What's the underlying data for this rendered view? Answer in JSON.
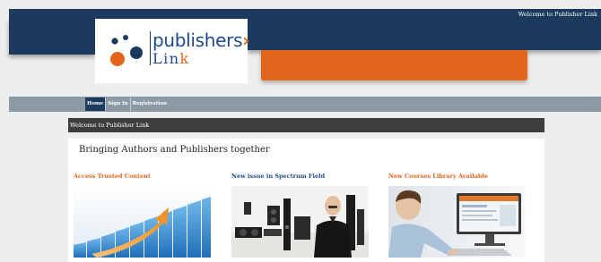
{
  "header": {
    "welcome_text": "Welcome to Publisher Link",
    "logo_word_1": "publishers",
    "logo_chevron": "›",
    "logo_word_2_main": "Lin",
    "logo_word_2_accent": "k"
  },
  "nav": {
    "items": [
      {
        "label": "Home",
        "active": true
      },
      {
        "label": "Sign In",
        "active": false
      },
      {
        "label": "Registration",
        "active": false
      }
    ]
  },
  "welcome_bar": {
    "text": "Welcome to Publisher Link"
  },
  "main": {
    "tagline": "Bringing Authors and Publishers together",
    "cards": [
      {
        "title": "Access Trusted Content",
        "title_color": "#e2651c",
        "image": "growth-arrow-graph"
      },
      {
        "title": "New issue in Spectrum Field",
        "title_color": "#1e4a8a",
        "image": "man-with-speakers-photo"
      },
      {
        "title": "New Courses Library Available",
        "title_color": "#e2651c",
        "image": "person-at-computer-photo"
      }
    ]
  },
  "colors": {
    "navy": "#1b3a5e",
    "orange": "#e2651c",
    "nav_gray": "#8c9aa5",
    "dark_bar": "#3e3e3e"
  }
}
